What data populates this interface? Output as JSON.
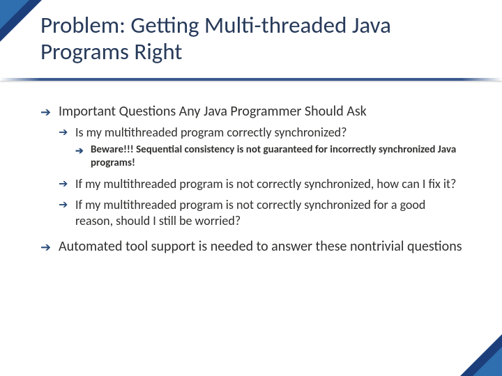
{
  "title": "Problem: Getting Multi-threaded Java Programs Right",
  "bullets": {
    "b1": "Important Questions Any Java Programmer Should Ask",
    "b1_1": "Is my multithreaded program correctly synchronized?",
    "b1_1_1": "Beware!!! Sequential consistency is not guaranteed for incorrectly synchronized Java programs!",
    "b1_2": "If my multithreaded program is not correctly synchronized, how can I fix it?",
    "b1_3": "If my multithreaded program is not correctly synchronized for a good reason, should I still be worried?",
    "b2": "Automated tool support is needed to answer these nontrivial questions"
  },
  "glyph": "➔"
}
